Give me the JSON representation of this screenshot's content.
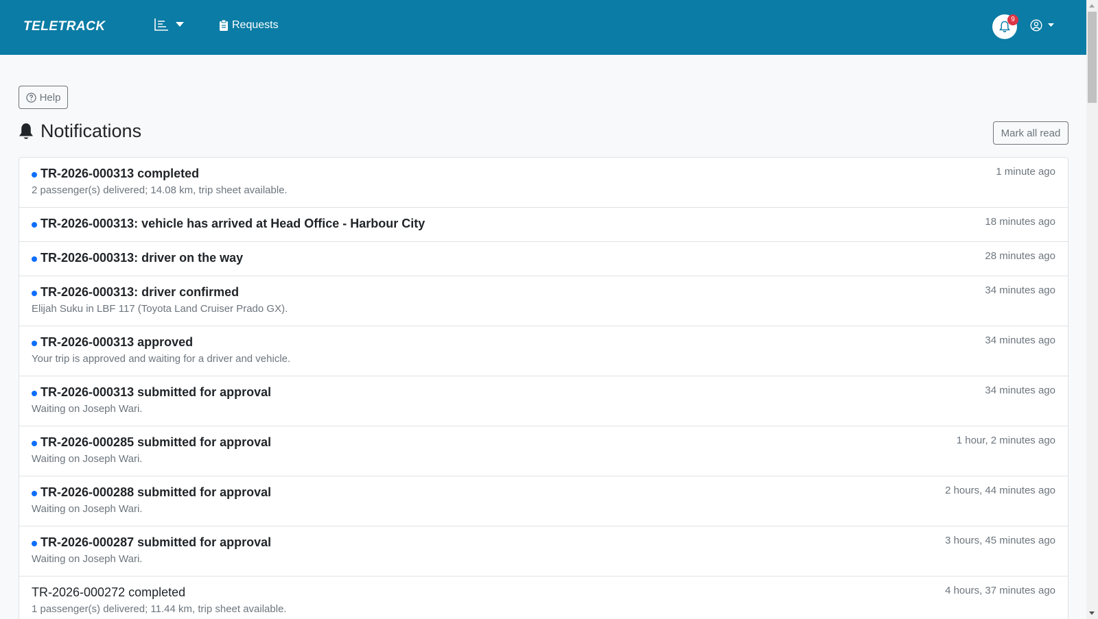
{
  "navbar": {
    "brand": "TELETRACK",
    "requests_label": "Requests",
    "notification_count": "9",
    "bg_color": "#0a7ca5"
  },
  "page": {
    "help_label": "Help",
    "title": "Notifications",
    "mark_all_label": "Mark all read"
  },
  "notifications": [
    {
      "title": "TR-2026-000313 completed",
      "body": "2 passenger(s) delivered; 14.08 km, trip sheet available.",
      "time": "1 minute ago",
      "unread": true
    },
    {
      "title": "TR-2026-000313: vehicle has arrived at Head Office - Harbour City",
      "body": "",
      "time": "18 minutes ago",
      "unread": true
    },
    {
      "title": "TR-2026-000313: driver on the way",
      "body": "",
      "time": "28 minutes ago",
      "unread": true
    },
    {
      "title": "TR-2026-000313: driver confirmed",
      "body": "Elijah Suku in LBF 117 (Toyota Land Cruiser Prado GX).",
      "time": "34 minutes ago",
      "unread": true
    },
    {
      "title": "TR-2026-000313 approved",
      "body": "Your trip is approved and waiting for a driver and vehicle.",
      "time": "34 minutes ago",
      "unread": true
    },
    {
      "title": "TR-2026-000313 submitted for approval",
      "body": "Waiting on Joseph Wari.",
      "time": "34 minutes ago",
      "unread": true
    },
    {
      "title": "TR-2026-000285 submitted for approval",
      "body": "Waiting on Joseph Wari.",
      "time": "1 hour, 2 minutes ago",
      "unread": true
    },
    {
      "title": "TR-2026-000288 submitted for approval",
      "body": "Waiting on Joseph Wari.",
      "time": "2 hours, 44 minutes ago",
      "unread": true
    },
    {
      "title": "TR-2026-000287 submitted for approval",
      "body": "Waiting on Joseph Wari.",
      "time": "3 hours, 45 minutes ago",
      "unread": true
    },
    {
      "title": "TR-2026-000272 completed",
      "body": "1 passenger(s) delivered; 11.44 km, trip sheet available.",
      "time": "4 hours, 37 minutes ago",
      "unread": false
    }
  ]
}
